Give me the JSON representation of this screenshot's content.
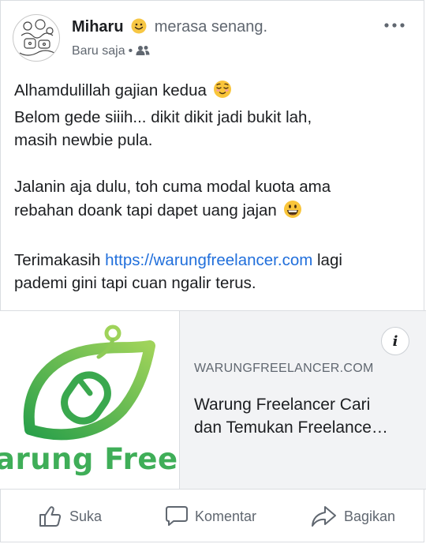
{
  "post": {
    "author": "Miharu",
    "feeling_text": "merasa senang.",
    "time": "Baru saja",
    "separator": "•",
    "privacy_icon": "friends-icon",
    "more_icon": "more-options-icon",
    "body_lines": {
      "l1": "Alhamdulillah gajian kedua",
      "l2": "Belom gede siiih... dikit dikit jadi bukit lah,",
      "l3": "masih newbie pula.",
      "l4": "Jalanin aja dulu, toh cuma modal kuota ama",
      "l5": "rebahan doank tapi dapet uang jajan",
      "l6_pre": "Terimakasih",
      "l6_link": "https://warungfreelancer.com",
      "l6_post": "lagi",
      "l7": "pademi gini tapi cuan ngalir terus."
    }
  },
  "link_card": {
    "logo_text": "arung Freelanc",
    "info_label": "i",
    "domain": "WARUNGFREELANCER.COM",
    "title_line1": "Warung Freelancer Cari",
    "title_line2": "dan Temukan Freelance…"
  },
  "actions": {
    "like": "Suka",
    "comment": "Komentar",
    "share": "Bagikan"
  },
  "colors": {
    "link": "#216fdb",
    "logo_green": "#2fa84a",
    "muted": "#606770"
  }
}
